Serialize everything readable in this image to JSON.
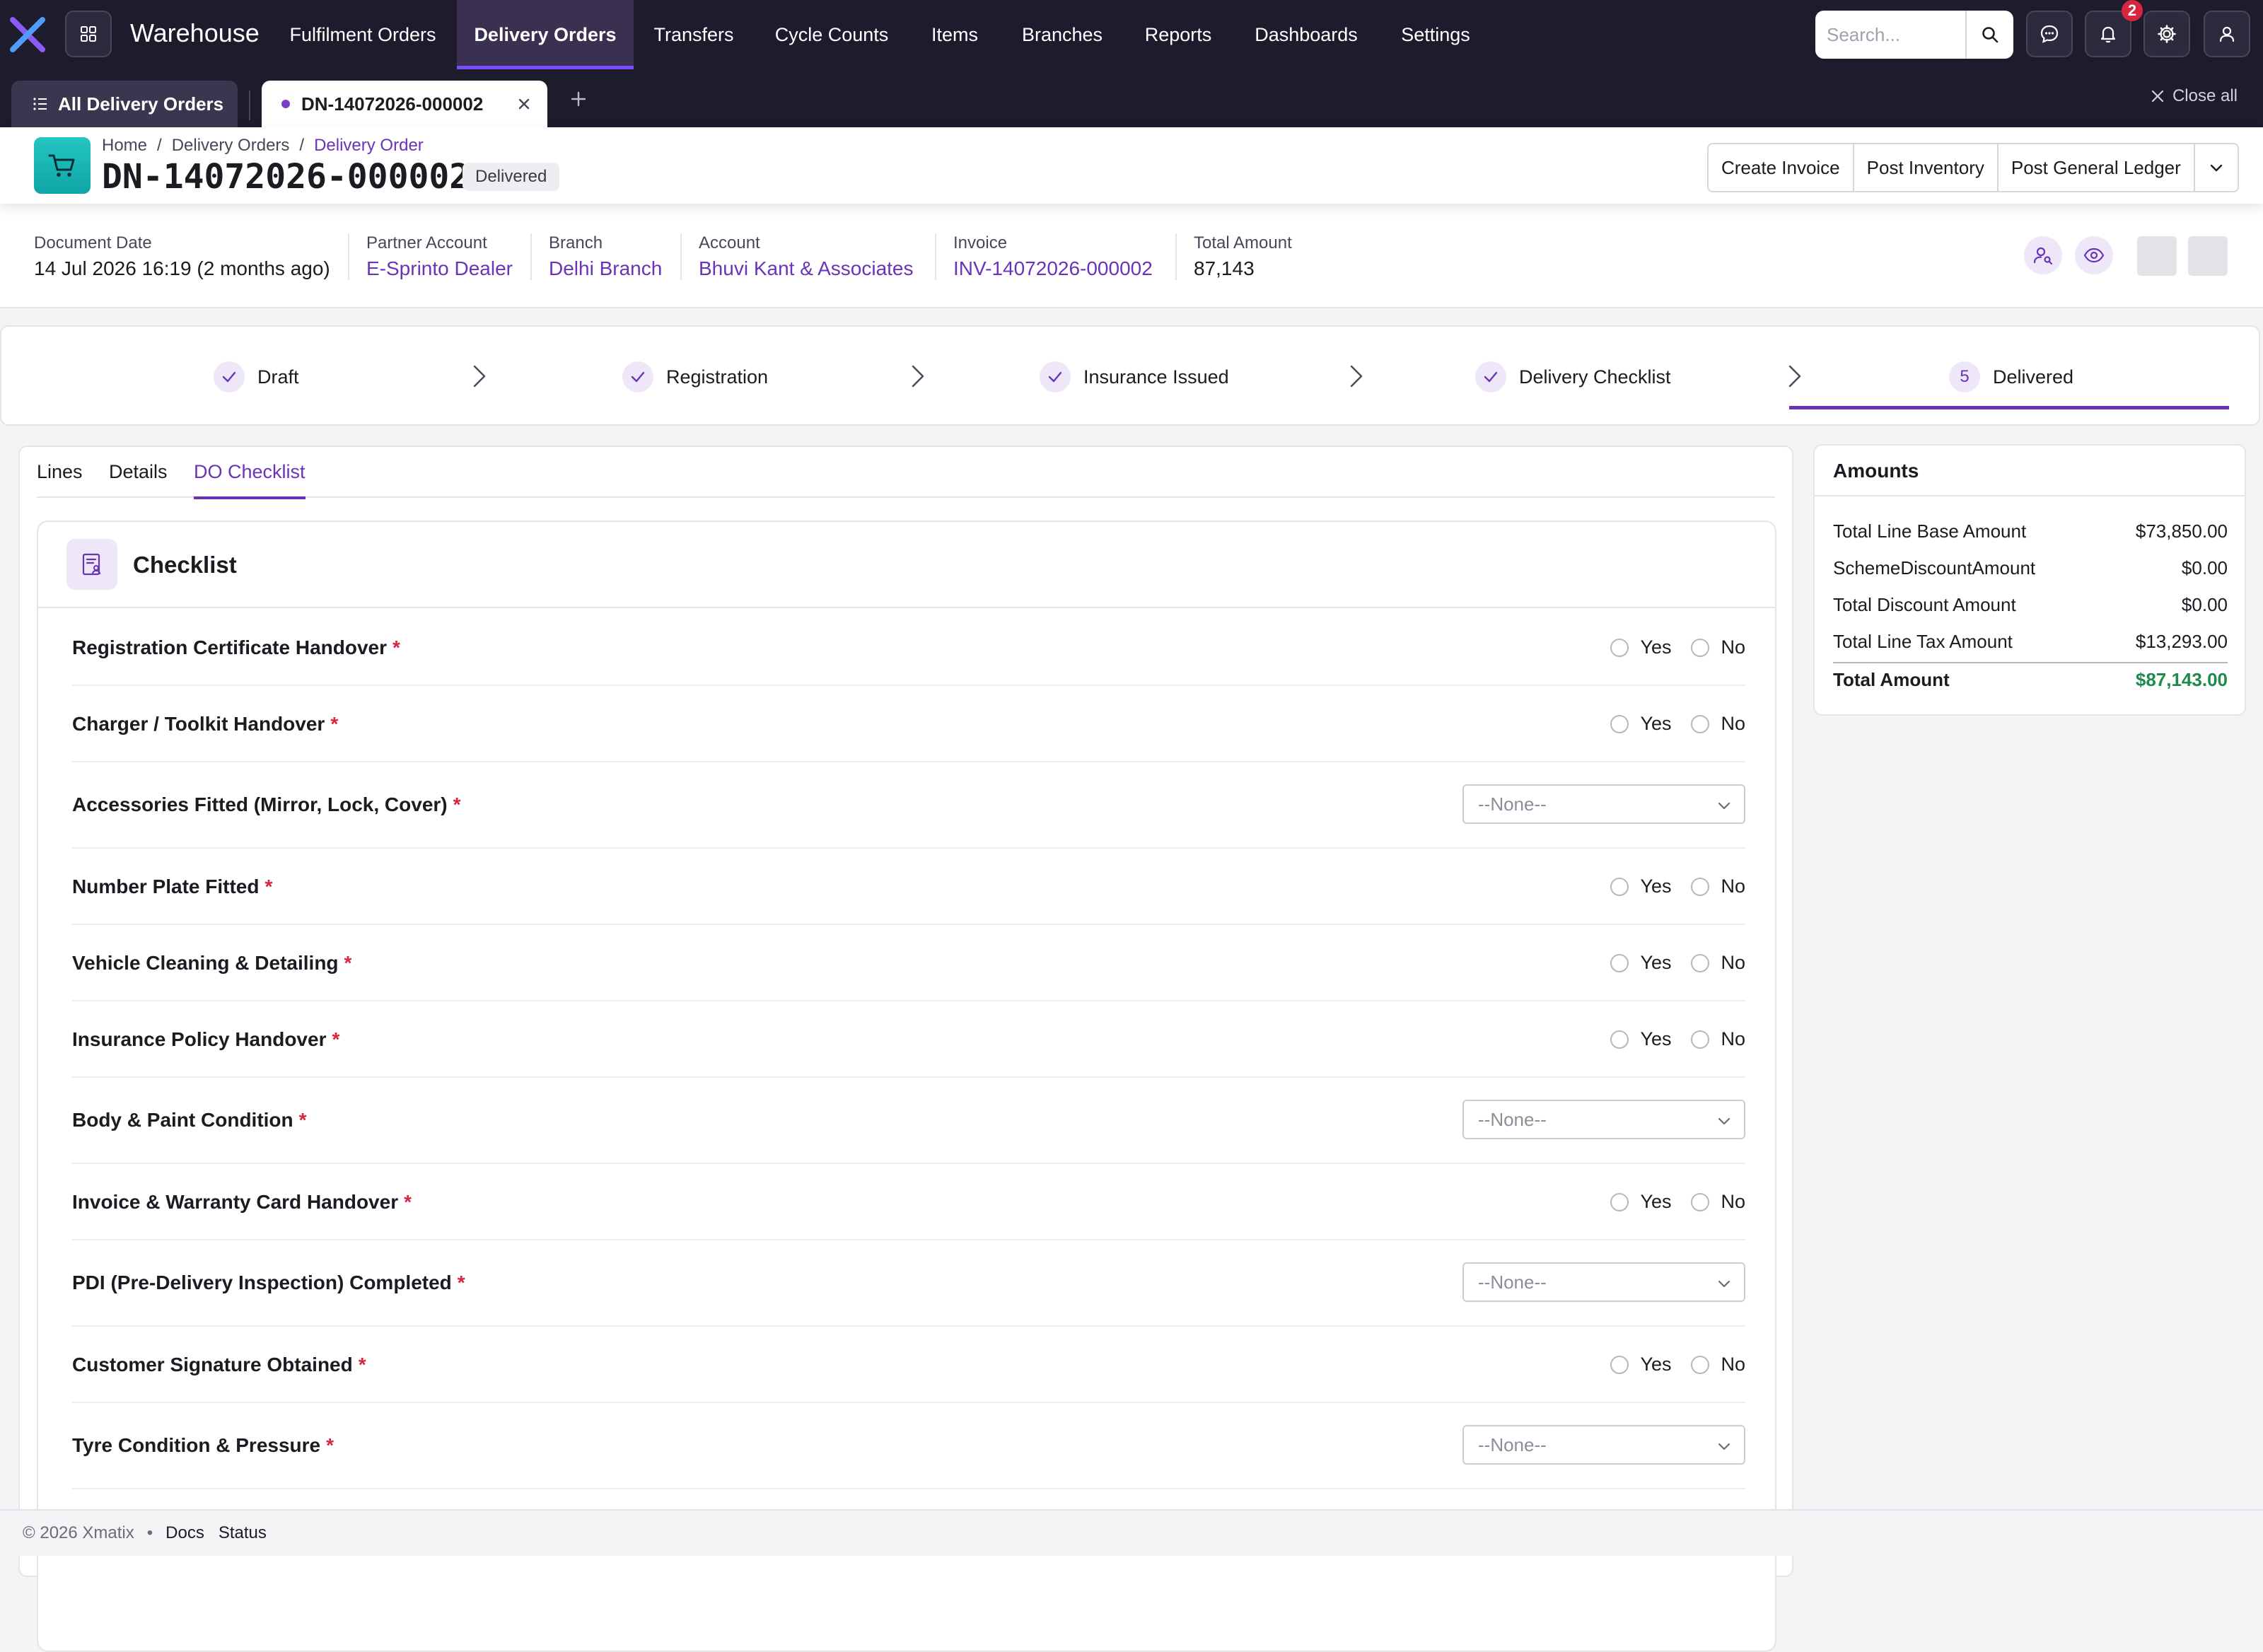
{
  "app": {
    "brand": "Warehouse",
    "nav": [
      "Fulfilment Orders",
      "Delivery Orders",
      "Transfers",
      "Cycle Counts",
      "Items",
      "Branches",
      "Reports",
      "Dashboards",
      "Settings"
    ],
    "active_nav": "Delivery Orders",
    "search_placeholder": "Search...",
    "notification_count": "2"
  },
  "tabs": {
    "list_tab": "All Delivery Orders",
    "doc_tab": "DN-14072026-000002",
    "close_all": "Close all"
  },
  "header": {
    "breadcrumb": [
      "Home",
      "Delivery Orders",
      "Delivery Order"
    ],
    "title": "DN-14072026-000002",
    "status": "Delivered",
    "actions": [
      "Create Invoice",
      "Post Inventory",
      "Post General Ledger"
    ]
  },
  "info": {
    "document_date_label": "Document Date",
    "document_date": "14 Jul 2026 16:19 (2 months ago)",
    "partner_label": "Partner Account",
    "partner": "E-Sprinto Dealer",
    "branch_label": "Branch",
    "branch": "Delhi Branch",
    "account_label": "Account",
    "account": "Bhuvi Kant & Associates",
    "invoice_label": "Invoice",
    "invoice": "INV-14072026-000002",
    "total_label": "Total Amount",
    "total": "87,143"
  },
  "stepper": {
    "steps": [
      "Draft",
      "Registration",
      "Insurance Issued",
      "Delivery Checklist",
      "Delivered"
    ],
    "active_number": "5"
  },
  "subtabs": [
    "Lines",
    "Details",
    "DO Checklist"
  ],
  "checklist": {
    "title": "Checklist",
    "yes": "Yes",
    "no": "No",
    "none": "--None--",
    "items": [
      "Registration Certificate Handover",
      "Charger / Toolkit Handover",
      "Accessories Fitted (Mirror, Lock, Cover)",
      "Number Plate Fitted",
      "Vehicle Cleaning & Detailing",
      "Insurance Policy Handover",
      "Body & Paint Condition",
      "Invoice & Warranty Card Handover",
      "PDI (Pre-Delivery Inspection) Completed",
      "Customer Signature Obtained",
      "Tyre Condition & Pressure"
    ]
  },
  "amounts": {
    "title": "Amounts",
    "rows": [
      {
        "label": "Total Line Base Amount",
        "value": "$73,850.00"
      },
      {
        "label": "SchemeDiscountAmount",
        "value": "$0.00"
      },
      {
        "label": "Total Discount Amount",
        "value": "$0.00"
      },
      {
        "label": "Total Line Tax Amount",
        "value": "$13,293.00"
      }
    ],
    "total_label": "Total Amount",
    "total_value": "$87,143.00"
  },
  "footer": {
    "copyright": "© 2026 Xmatix",
    "links": [
      "Docs",
      "Status"
    ]
  },
  "colors": {
    "nav_bg": "#1e1b2c",
    "accent": "#6a33b8",
    "required": "#d7263d",
    "total_green": "#1f8a4c",
    "doc_icon": "#14b8b4"
  }
}
